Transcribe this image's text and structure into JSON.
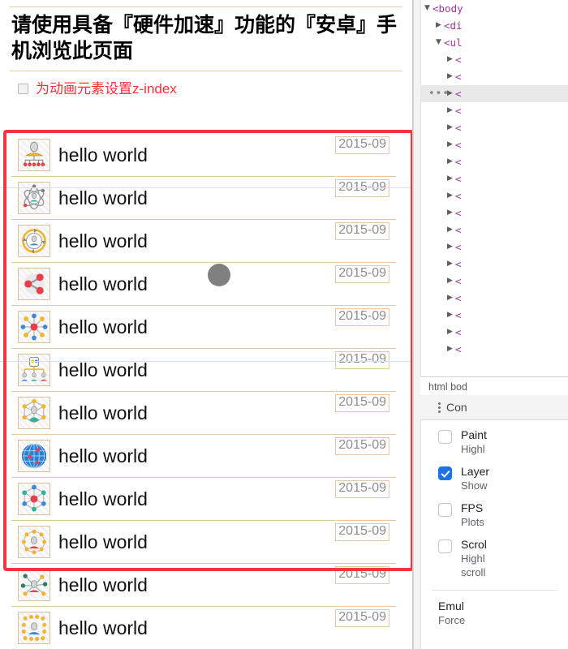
{
  "page": {
    "header_title": "请使用具备『硬件加速』功能的『安卓』手机浏览此页面",
    "option_label": "为动画元素设置z-index",
    "option_checked": false,
    "accent_red": "#f92f3c",
    "highlight_border": "#f5343f",
    "row_border": "#e3c9a8",
    "ball_color": "#808080",
    "rows": [
      {
        "icon": "people-network-icon",
        "title": "hello world",
        "date": "2015-09"
      },
      {
        "icon": "atom-person-icon",
        "title": "hello world",
        "date": "2015-09"
      },
      {
        "icon": "person-circle-cycle-icon",
        "title": "hello world",
        "date": "2015-09"
      },
      {
        "icon": "share-nodes-icon",
        "title": "hello world",
        "date": "2015-09"
      },
      {
        "icon": "hub-spoke-icon",
        "title": "hello world",
        "date": "2015-09"
      },
      {
        "icon": "org-chart-icon",
        "title": "hello world",
        "date": "2015-09"
      },
      {
        "icon": "hexagon-network-heart-icon",
        "title": "hello world",
        "date": "2015-09"
      },
      {
        "icon": "globe-pins-icon",
        "title": "hello world",
        "date": "2015-09"
      },
      {
        "icon": "hexagon-node-red-icon",
        "title": "hello world",
        "date": "2015-09"
      },
      {
        "icon": "person-ring-nodes-icon",
        "title": "hello world",
        "date": "2015-09"
      },
      {
        "icon": "person-scatter-nodes-icon",
        "title": "hello world",
        "date": "2015-09"
      },
      {
        "icon": "person-dots-grid-icon",
        "title": "hello world",
        "date": "2015-09"
      }
    ]
  },
  "devtools": {
    "tree": [
      {
        "indent": 0,
        "arrow": "▼",
        "text": "<body",
        "selected": false
      },
      {
        "indent": 1,
        "arrow": "▶",
        "text": "<di",
        "selected": false
      },
      {
        "indent": 1,
        "arrow": "▼",
        "text": "<ul",
        "selected": false
      },
      {
        "indent": 2,
        "arrow": "▶",
        "text": "<",
        "selected": false
      },
      {
        "indent": 2,
        "arrow": "▶",
        "text": "<",
        "selected": false
      },
      {
        "indent": 2,
        "arrow": "▶",
        "text": "<",
        "selected": true
      },
      {
        "indent": 2,
        "arrow": "▶",
        "text": "<",
        "selected": false
      },
      {
        "indent": 2,
        "arrow": "▶",
        "text": "<",
        "selected": false
      },
      {
        "indent": 2,
        "arrow": "▶",
        "text": "<",
        "selected": false
      },
      {
        "indent": 2,
        "arrow": "▶",
        "text": "<",
        "selected": false
      },
      {
        "indent": 2,
        "arrow": "▶",
        "text": "<",
        "selected": false
      },
      {
        "indent": 2,
        "arrow": "▶",
        "text": "<",
        "selected": false
      },
      {
        "indent": 2,
        "arrow": "▶",
        "text": "<",
        "selected": false
      },
      {
        "indent": 2,
        "arrow": "▶",
        "text": "<",
        "selected": false
      },
      {
        "indent": 2,
        "arrow": "▶",
        "text": "<",
        "selected": false
      },
      {
        "indent": 2,
        "arrow": "▶",
        "text": "<",
        "selected": false
      },
      {
        "indent": 2,
        "arrow": "▶",
        "text": "<",
        "selected": false
      },
      {
        "indent": 2,
        "arrow": "▶",
        "text": "<",
        "selected": false
      },
      {
        "indent": 2,
        "arrow": "▶",
        "text": "<",
        "selected": false
      },
      {
        "indent": 2,
        "arrow": "▶",
        "text": "<",
        "selected": false
      },
      {
        "indent": 2,
        "arrow": "▶",
        "text": "<",
        "selected": false
      }
    ],
    "ellipsis": "•••",
    "breadcrumb": "html   bod",
    "drawer_title": "Con",
    "rendering_options": [
      {
        "label": "Paint",
        "sub": "Highl",
        "checked": false
      },
      {
        "label": "Layer",
        "sub": "Show",
        "checked": true
      },
      {
        "label": "FPS",
        "sub": "Plots",
        "checked": false
      },
      {
        "label": "Scrol",
        "sub": "Highl",
        "sub2": "scroll",
        "checked": false
      }
    ],
    "emulate_label": "Emul",
    "emulate_sub": "Force"
  }
}
